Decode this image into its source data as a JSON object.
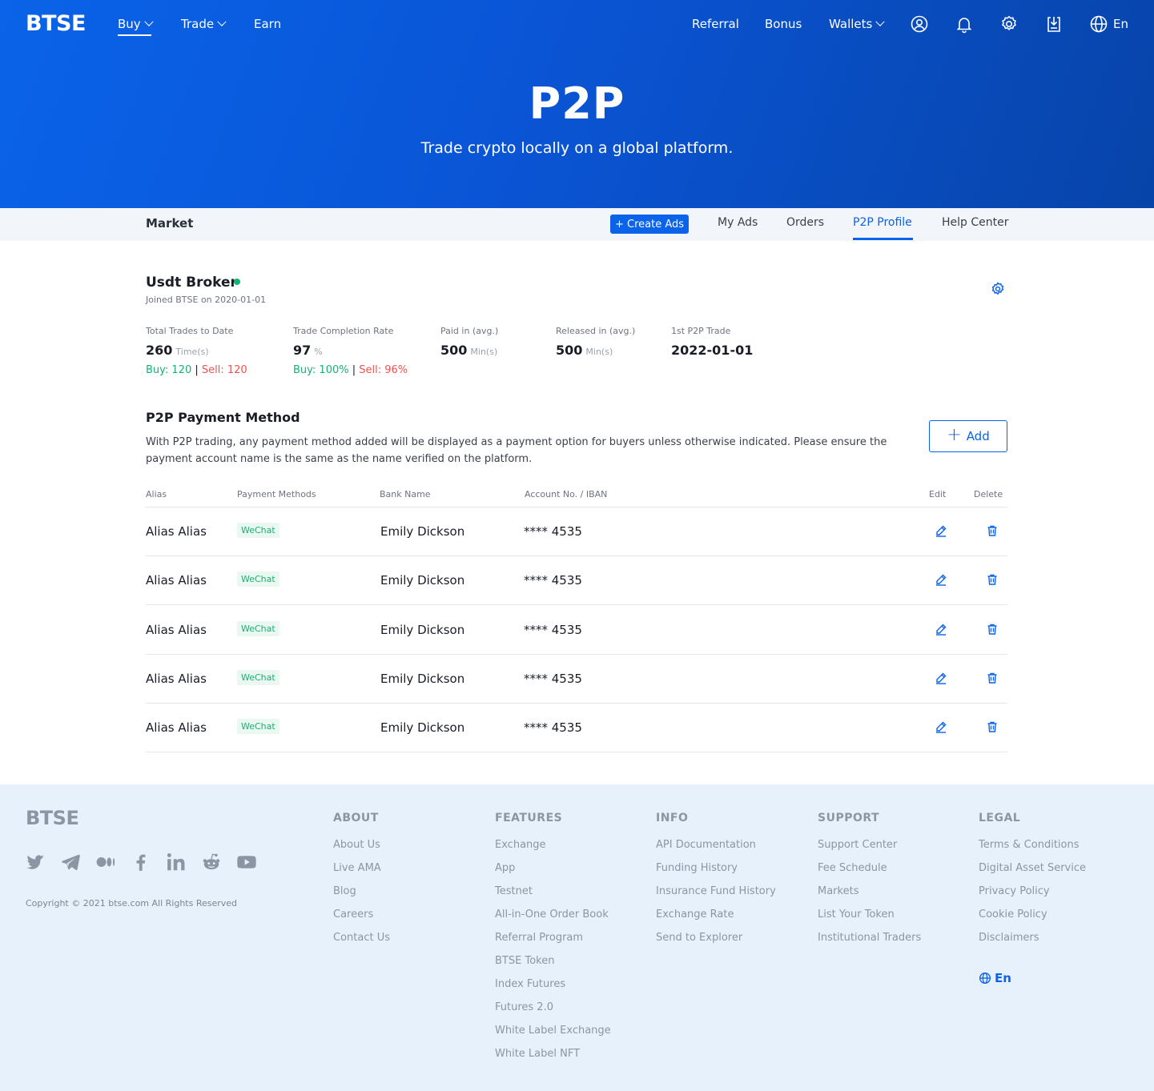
{
  "header": {
    "logo": "BTSE",
    "nav": [
      {
        "label": "Buy",
        "dropdown": true
      },
      {
        "label": "Trade",
        "dropdown": true
      },
      {
        "label": "Earn",
        "dropdown": false
      }
    ],
    "right_nav": [
      {
        "label": "Referral"
      },
      {
        "label": "Bonus"
      },
      {
        "label": "Wallets",
        "dropdown": true
      }
    ],
    "icons": [
      "user-icon",
      "bell-icon",
      "gear-icon",
      "download-icon",
      "globe-icon"
    ],
    "language": "En"
  },
  "hero": {
    "title": "P2P",
    "subtitle": "Trade crypto locally on a global platform."
  },
  "subnav": {
    "market": "Market",
    "create_ads": "+ Create Ads",
    "tabs": [
      {
        "label": "My Ads",
        "active": false
      },
      {
        "label": "Orders",
        "active": false
      },
      {
        "label": "P2P Profile",
        "active": true
      },
      {
        "label": "Help Center",
        "active": false
      }
    ]
  },
  "profile": {
    "name": "Usdt Broker",
    "joined": "Joined BTSE on 2020-01-01",
    "stats": [
      {
        "label": "Total Trades to Date",
        "value": "260",
        "unit": "Time(s)",
        "buy": "Buy: 120",
        "sep": "|",
        "sell": "Sell: 120"
      },
      {
        "label": "Trade Completion Rate",
        "value": "97",
        "unit": "%",
        "buy": "Buy: 100%",
        "sep": "|",
        "sell": "Sell: 96%"
      },
      {
        "label": "Paid in (avg.)",
        "value": "500",
        "unit": "Min(s)"
      },
      {
        "label": "Released in (avg.)",
        "value": "500",
        "unit": "Min(s)"
      },
      {
        "label": "1st P2P Trade",
        "value": "2022-01-01",
        "unit": ""
      }
    ]
  },
  "payment": {
    "title": "P2P Payment Method",
    "description": "With P2P trading, any payment method added will be displayed as a payment option for buyers unless otherwise indicated. Please ensure the payment account name is the same as the name verified on the platform.",
    "add_label": "Add",
    "columns": [
      "Alias",
      "Payment Methods",
      "Bank Name",
      "Account No. / IBAN",
      "Edit",
      "Delete"
    ],
    "rows": [
      {
        "alias": "Alias Alias",
        "method": "WeChat",
        "bank": "Emily Dickson",
        "account": "**** 4535"
      },
      {
        "alias": "Alias Alias",
        "method": "WeChat",
        "bank": "Emily Dickson",
        "account": "**** 4535"
      },
      {
        "alias": "Alias Alias",
        "method": "WeChat",
        "bank": "Emily Dickson",
        "account": "**** 4535"
      },
      {
        "alias": "Alias Alias",
        "method": "WeChat",
        "bank": "Emily Dickson",
        "account": "**** 4535"
      },
      {
        "alias": "Alias Alias",
        "method": "WeChat",
        "bank": "Emily Dickson",
        "account": "**** 4535"
      }
    ]
  },
  "footer": {
    "logo": "BTSE",
    "social_icons": [
      "twitter-icon",
      "telegram-icon",
      "medium-icon",
      "facebook-icon",
      "linkedin-icon",
      "reddit-icon",
      "youtube-icon"
    ],
    "copyright": "Copyright © 2021 btse.com All Rights Reserved",
    "columns": [
      {
        "title": "ABOUT",
        "links": [
          "About Us",
          "Live AMA",
          "Blog",
          "Careers",
          "Contact Us"
        ]
      },
      {
        "title": "FEATURES",
        "links": [
          "Exchange",
          "App",
          "Testnet",
          "All-in-One Order Book",
          "Referral Program",
          "BTSE Token",
          "Index Futures",
          "Futures 2.0",
          "White Label Exchange",
          "White Label NFT"
        ]
      },
      {
        "title": "INFO",
        "links": [
          "API Documentation",
          "Funding History",
          "Insurance Fund History",
          "Exchange Rate",
          "Send to Explorer"
        ]
      },
      {
        "title": "SUPPORT",
        "links": [
          "Support Center",
          "Fee Schedule",
          "Markets",
          "List Your Token",
          "Institutional Traders"
        ]
      },
      {
        "title": "LEGAL",
        "links": [
          "Terms & Conditions",
          "Digital Asset Service",
          "Privacy Policy",
          "Cookie Policy",
          "Disclaimers"
        ]
      }
    ],
    "language": "En"
  },
  "colors": {
    "primary": "#0a63e8",
    "buy_green": "#15b275",
    "sell_red": "#f0524f",
    "footer_bg": "#e7f1fb"
  }
}
